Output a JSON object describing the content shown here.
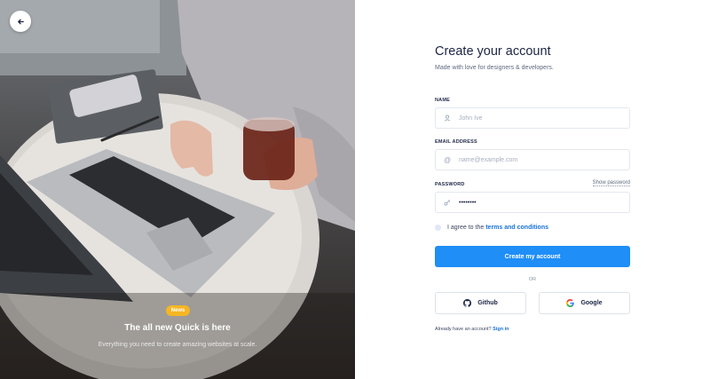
{
  "hero": {
    "badge": "News",
    "title": "The all new Quick is here",
    "subtitle": "Everything you need to create amazing websites at scale."
  },
  "form": {
    "title": "Create your account",
    "subtitle": "Made with love for designers & developers.",
    "name_label": "NAME",
    "name_placeholder": "John Ive",
    "email_label": "EMAIL ADDRESS",
    "email_placeholder": "name@example.com",
    "password_label": "PASSWORD",
    "password_value": "••••••••",
    "show_password": "Show password",
    "agree_text": "I agree to the ",
    "terms_link": "terms and conditions",
    "submit": "Create my account",
    "or": "OR",
    "github": "Github",
    "google": "Google",
    "have_account": "Already have an account? ",
    "signin": "Sign in"
  },
  "colors": {
    "primary": "#1f8ef7",
    "badge": "#f5b623",
    "heading": "#1b2443"
  }
}
